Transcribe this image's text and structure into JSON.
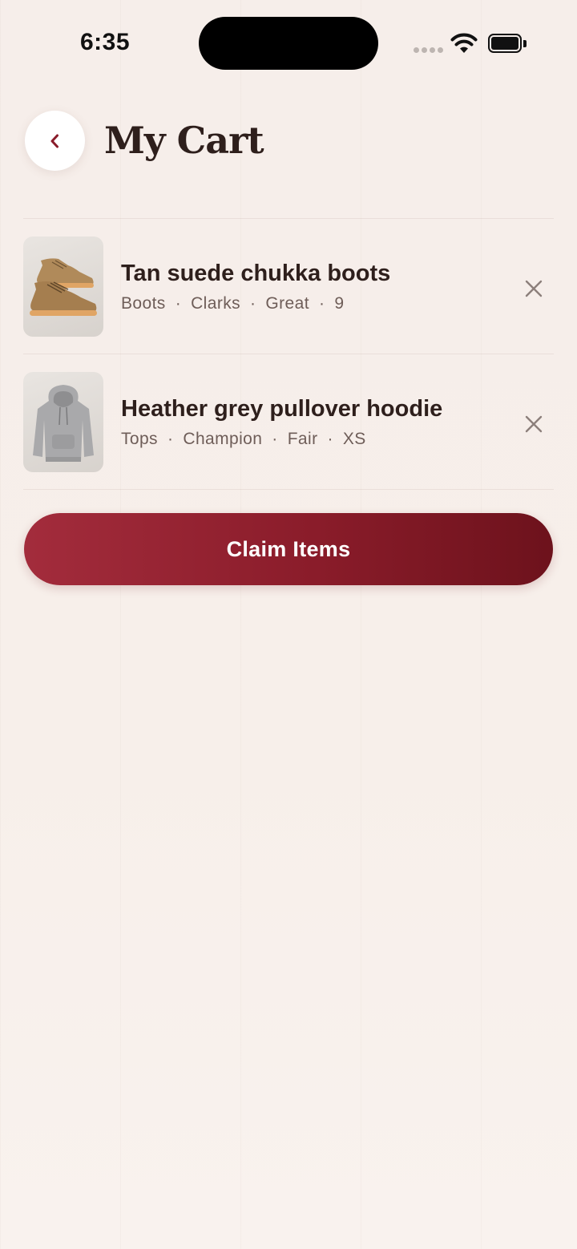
{
  "status_bar": {
    "time": "6:35"
  },
  "header": {
    "title": "My Cart"
  },
  "cart": {
    "items": [
      {
        "title": "Tan suede chukka boots",
        "category": "Boots",
        "brand": "Clarks",
        "condition": "Great",
        "size": "9",
        "image_icon": "chukka-boots-image"
      },
      {
        "title": "Heather grey pullover hoodie",
        "category": "Tops",
        "brand": "Champion",
        "condition": "Fair",
        "size": "XS",
        "image_icon": "hoodie-image"
      }
    ],
    "separator": "·"
  },
  "actions": {
    "claim_label": "Claim Items"
  },
  "colors": {
    "accent": "#8a1c2a",
    "background": "#f7efea",
    "text_primary": "#2e1f1c",
    "text_secondary": "#6e5d58"
  }
}
